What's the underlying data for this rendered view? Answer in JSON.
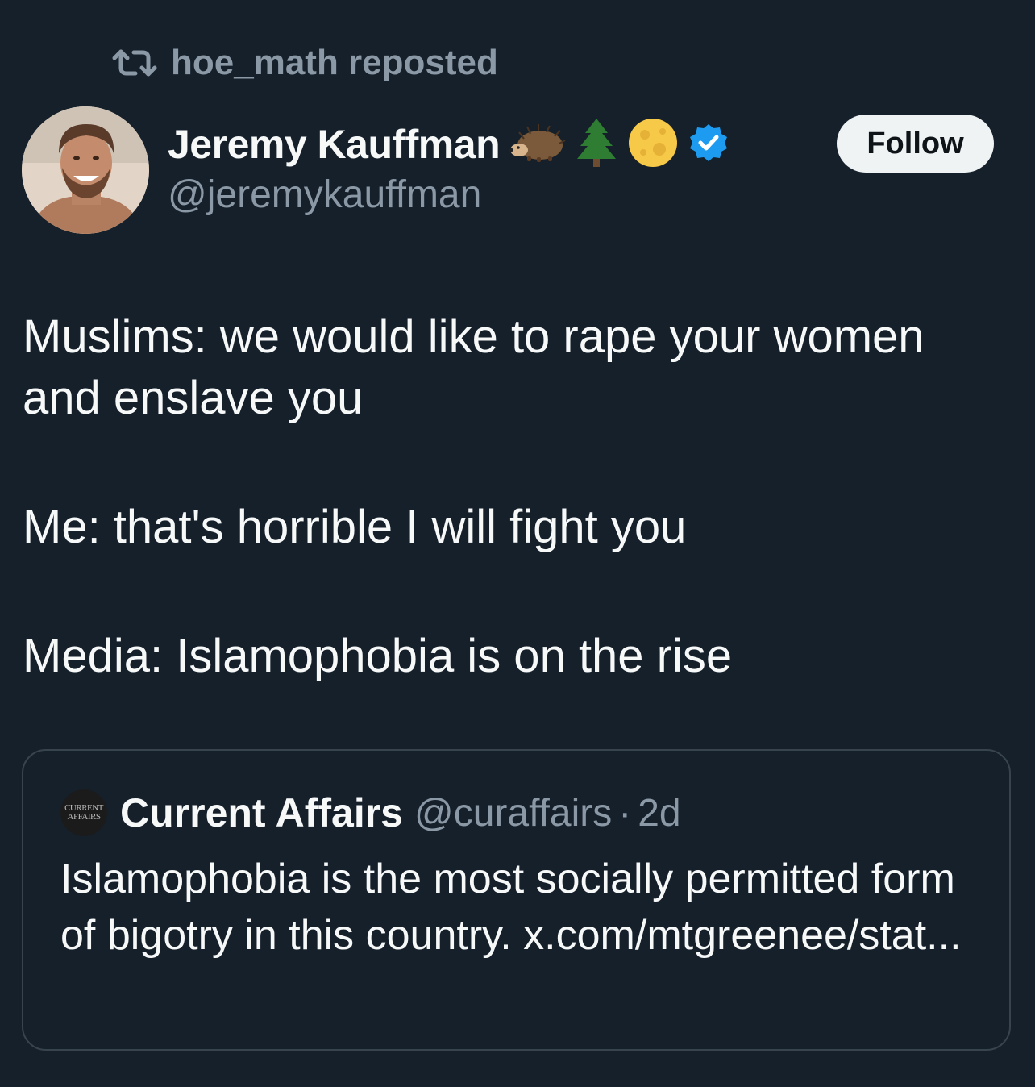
{
  "repost": {
    "label": "hoe_math reposted"
  },
  "author": {
    "display_name": "Jeremy Kauffman",
    "emojis": [
      "hedgehog",
      "tree",
      "moon"
    ],
    "verified": true,
    "handle": "@jeremykauffman"
  },
  "follow_button": {
    "label": "Follow"
  },
  "tweet": {
    "paragraphs": [
      "Muslims: we would like to rape your women and enslave you",
      "Me: that's horrible I will fight you",
      "Media: Islamophobia is on the rise"
    ]
  },
  "quoted_tweet": {
    "avatar_text_line1": "CURRENT",
    "avatar_text_line2": "AFFAIRS",
    "display_name": "Current Affairs",
    "handle": "@curaffairs",
    "dot": "·",
    "time": "2d",
    "text": "Islamophobia is the most socially permitted form of bigotry in this country. x.com/mtgreenee/stat..."
  },
  "colors": {
    "background": "#15202b",
    "text_primary": "#f7f9f9",
    "text_secondary": "#8b98a5",
    "verified_blue": "#1d9bf0",
    "border": "#38444d",
    "follow_bg": "#eff3f4"
  }
}
